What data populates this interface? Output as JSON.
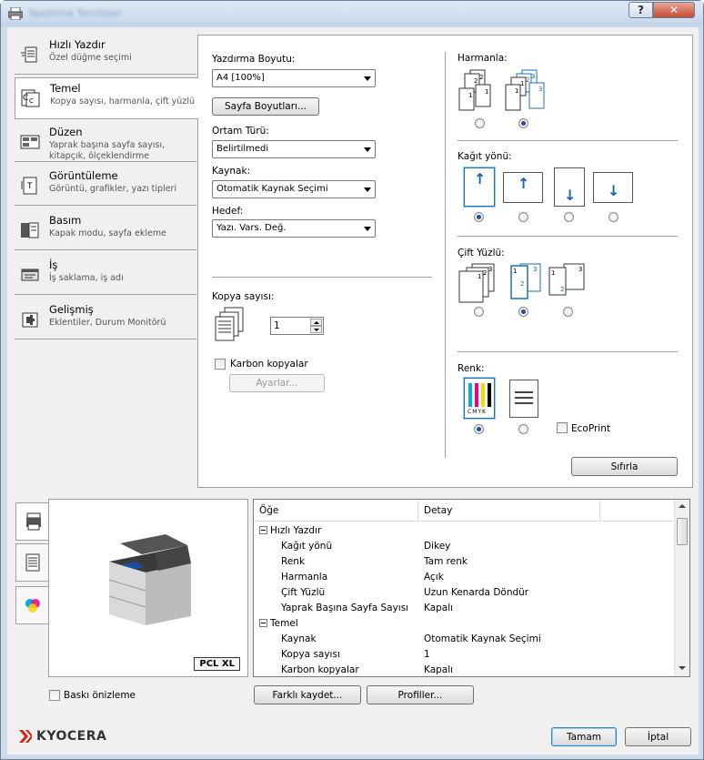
{
  "window": {
    "title": "Yazdırma Tercihleri",
    "help_label": "?",
    "close_label": "✕"
  },
  "nav": {
    "items": [
      {
        "title": "Hızlı Yazdır",
        "sub": "Özel düğme seçimi",
        "icon": "quick-print-icon"
      },
      {
        "title": "Temel",
        "sub": "Kopya sayısı, harmanla, çift yüzlü",
        "icon": "basic-icon"
      },
      {
        "title": "Düzen",
        "sub": "Yaprak başına sayfa sayısı, kitapçık, ölçeklendirme",
        "icon": "layout-icon"
      },
      {
        "title": "Görüntüleme",
        "sub": "Görüntü, grafikler, yazı tipleri",
        "icon": "imaging-icon"
      },
      {
        "title": "Basım",
        "sub": "Kapak modu, sayfa ekleme",
        "icon": "publishing-icon"
      },
      {
        "title": "İş",
        "sub": "İş saklama, iş adı",
        "icon": "job-icon"
      },
      {
        "title": "Gelişmiş",
        "sub": "Eklentiler, Durum Monitörü",
        "icon": "advanced-icon"
      }
    ]
  },
  "basic": {
    "print_size_label": "Yazdırma Boyutu:",
    "print_size_value": "A4 [100%]",
    "page_sizes_button": "Sayfa Boyutları...",
    "media_type_label": "Ortam Türü:",
    "media_type_value": "Belirtilmedi",
    "source_label": "Kaynak:",
    "source_value": "Otomatik Kaynak Seçimi",
    "destination_label": "Hedef:",
    "destination_value": "Yazı. Vars. Değ.",
    "copies_label": "Kopya sayısı:",
    "copies_value": "1",
    "carbon_label": "Karbon kopyalar",
    "settings_button": "Ayarlar...",
    "collate_label": "Harmanla:",
    "orientation_label": "Kağıt yönü:",
    "duplex_label": "Çift Yüzlü:",
    "color_label": "Renk:",
    "ecoprint_label": "EcoPrint",
    "reset_button": "Sıfırla",
    "cmyk_text": "CMYK"
  },
  "details": {
    "col_item": "Öğe",
    "col_detail": "Detay",
    "rows": [
      {
        "item": "Hızlı Yazdır",
        "detail": "",
        "group": true
      },
      {
        "item": "Kağıt yönü",
        "detail": "Dikey",
        "group": false
      },
      {
        "item": "Renk",
        "detail": "Tam renk",
        "group": false
      },
      {
        "item": "Harmanla",
        "detail": "Açık",
        "group": false
      },
      {
        "item": "Çift Yüzlü",
        "detail": "Uzun Kenarda Döndür",
        "group": false
      },
      {
        "item": "Yaprak Başına Sayfa Sayısı",
        "detail": "Kapalı",
        "group": false
      },
      {
        "item": "Temel",
        "detail": "",
        "group": true
      },
      {
        "item": "Kaynak",
        "detail": "Otomatik Kaynak Seçimi",
        "group": false
      },
      {
        "item": "Kopya sayısı",
        "detail": "1",
        "group": false
      },
      {
        "item": "Karbon kopyalar",
        "detail": "Kapalı",
        "group": false
      }
    ]
  },
  "preview": {
    "badge": "PCL XL",
    "print_preview_label": "Baskı önizleme"
  },
  "footer": {
    "save_as_button": "Farklı kaydet...",
    "profiles_button": "Profiller...",
    "brand": "KYOCERA",
    "ok_button": "Tamam",
    "cancel_button": "İptal"
  },
  "colors": {
    "accent": "#1f6fb5",
    "brand_red": "#d4201a"
  }
}
